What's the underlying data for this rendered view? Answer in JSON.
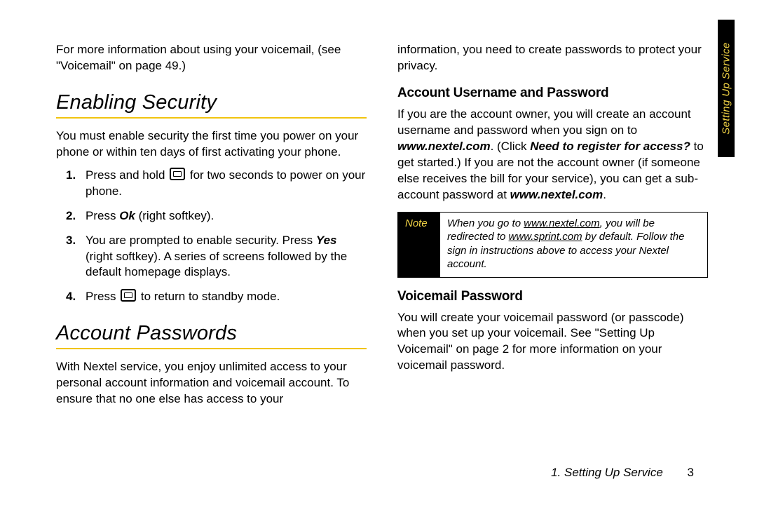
{
  "sideTab": "Setting Up Service",
  "footer": {
    "chapter": "1. Setting Up Service",
    "page": "3"
  },
  "left": {
    "introLine": "For more information about using your voicemail, (see \"Voicemail\" on page 49.)",
    "sec1": {
      "title": "Enabling Security",
      "para": "You must enable security the first time you power on your phone or within ten days of first activating your phone.",
      "step1_a": "Press and hold ",
      "step1_b": " for two seconds to power on your phone.",
      "step2_a": "Press ",
      "step2_ok": "Ok",
      "step2_b": " (right softkey).",
      "step3_a": "You are prompted to enable security. Press ",
      "step3_yes": "Yes",
      "step3_b": " (right softkey). A series of screens followed by the default homepage displays.",
      "step4_a": "Press ",
      "step4_b": " to return to standby mode."
    },
    "sec2": {
      "title": "Account Passwords",
      "para": "With Nextel service, you enjoy unlimited access to your personal account information and voicemail account. To ensure that no one else has access to your"
    }
  },
  "right": {
    "lead": "information, you need to create passwords to protect your privacy.",
    "sub1": {
      "title": "Account Username and Password",
      "p_a": "If you are the account owner, you will create an account username and password when you sign on to ",
      "url1": "www.nextel.com",
      "p_b": ". (Click ",
      "need": "Need to register for access?",
      "p_c": " to get started.) If you are not the account owner (if someone else receives the bill for your service), you can get a sub-account password at ",
      "url2": "www.nextel.com",
      "p_d": "."
    },
    "note": {
      "label": "Note",
      "a": "When you go to ",
      "u1": "www.nextel.com",
      "b": ", you will be redirected to ",
      "u2": "www.sprint.com",
      "c": " by default. Follow the sign in instructions above to access your Nextel account."
    },
    "sub2": {
      "title": "Voicemail Password",
      "para": "You will create your voicemail password (or passcode) when you set up your voicemail. See \"Setting Up Voicemail\" on page 2 for more information on your voicemail password."
    }
  }
}
